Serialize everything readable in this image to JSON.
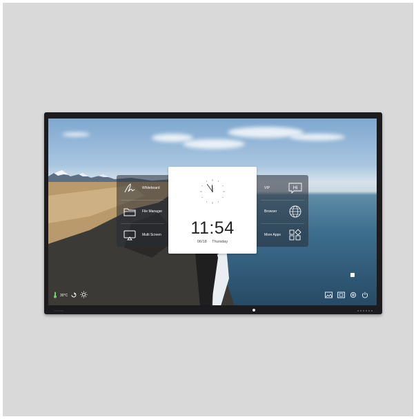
{
  "left_menu": {
    "items": [
      {
        "label": "Whiteboard",
        "icon": "pen-icon"
      },
      {
        "label": "File Manager",
        "icon": "folder-icon"
      },
      {
        "label": "Multi Screen",
        "icon": "cast-icon"
      }
    ]
  },
  "right_menu": {
    "items": [
      {
        "label": "VIP",
        "icon": "hi-chat-icon",
        "icon_text": "Hi"
      },
      {
        "label": "Browser",
        "icon": "globe-icon"
      },
      {
        "label": "More Apps",
        "icon": "apps-grid-icon"
      }
    ]
  },
  "clock": {
    "time": "11:54",
    "date": "06/18",
    "weekday": "Thursday",
    "analog_hour": 11,
    "analog_minute": 54
  },
  "status_bar": {
    "temperature": "30°C",
    "icons": [
      "thermometer-icon",
      "eye-care-icon",
      "brightness-icon"
    ],
    "right_icons": [
      "wallpaper-icon",
      "screenshot-icon",
      "settings-icon",
      "power-icon"
    ]
  },
  "colors": {
    "panel": "#2c3038",
    "card": "#ffffff",
    "accent_green": "#6dd36a",
    "bezel": "#1c1c1e"
  }
}
